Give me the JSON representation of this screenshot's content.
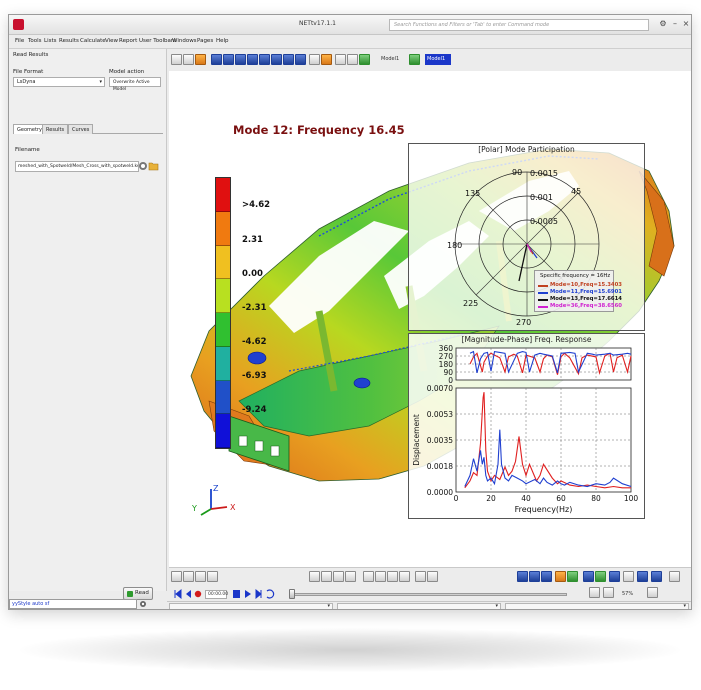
{
  "window": {
    "title": "NETtv17.1.1",
    "command_placeholder": "Search Functions and Filters or 'Tab' to enter Command mode",
    "search_icon_name": "search-icon"
  },
  "menubar": {
    "items": [
      "File",
      "Tools",
      "Lists",
      "Results",
      "Calculate",
      "View",
      "Report",
      "User Toolbars",
      "Windows",
      "Pages",
      "Help"
    ]
  },
  "toolbar_top": {
    "model_label": "Model1",
    "model_chip": "Model1"
  },
  "left_panel": {
    "section_title": "Read Results",
    "file_format_label": "File Format",
    "file_format_value": "LsDyna",
    "model_action_label": "Model action",
    "model_action_value": "Overwrite Active Model",
    "tabs": [
      "Geometry",
      "Results",
      "Curves"
    ],
    "filename_label": "Filename",
    "filename_value": "meshed_with_Spotweld/Mesh_Cross_with_spotweld.key",
    "read_button": "Read"
  },
  "command_input": {
    "value": "yyStyle auto sf"
  },
  "viewport": {
    "title": "Mode 12:  Frequency 16.45",
    "colorbar": {
      "labels": [
        ">4.62",
        "2.31",
        "0.00",
        "-2.31",
        "-4.62",
        "-6.93",
        "-9.24"
      ],
      "colors": [
        "#e01010",
        "#f07a10",
        "#f0c020",
        "#b8e020",
        "#30c030",
        "#20b0a0",
        "#2050c8",
        "#1010d8"
      ]
    },
    "triad": {
      "x": "X",
      "y": "Y",
      "z": "Z"
    }
  },
  "polar_plot": {
    "title": "[Polar] Mode Participation",
    "radial_labels": [
      "0.0015",
      "0.001",
      "0.0005"
    ],
    "angle_labels": [
      "90",
      "45",
      "135",
      "180",
      "225",
      "270"
    ],
    "legend_title": "Specific frequency = 16Hz",
    "legend": [
      {
        "label": "Mode=10,Freq=15.3403",
        "color": "#c04020"
      },
      {
        "label": "Mode=11,Freq=15.6901",
        "color": "#2040d0"
      },
      {
        "label": "Mode=13,Freq=17.6614",
        "color": "#111111"
      },
      {
        "label": "Mode=36,Freq=38.6560",
        "color": "#d020d0"
      }
    ]
  },
  "chart_data": [
    {
      "type": "line",
      "title": "[Magnitude-Phase] Freq. Response",
      "panel": "phase",
      "ytick_labels": [
        "360",
        "270",
        "180",
        "90",
        "0"
      ],
      "ylim": [
        0,
        360
      ],
      "xlim": [
        0,
        100
      ],
      "series": [
        {
          "color": "#e02020",
          "x": [
            8,
            10,
            12,
            15,
            16,
            18,
            20,
            22,
            25,
            28,
            30,
            33,
            35,
            38,
            40,
            45,
            48,
            50,
            52,
            55,
            58,
            60,
            62,
            65,
            70,
            72,
            75,
            80,
            82,
            85,
            88,
            90,
            92,
            95,
            98,
            100
          ],
          "y": [
            180,
            260,
            300,
            90,
            200,
            270,
            300,
            280,
            250,
            90,
            260,
            290,
            270,
            80,
            280,
            250,
            90,
            240,
            280,
            260,
            60,
            260,
            300,
            250,
            70,
            250,
            280,
            260,
            80,
            270,
            300,
            90,
            250,
            280,
            90,
            270
          ]
        },
        {
          "color": "#2040d0",
          "x": [
            8,
            10,
            12,
            14,
            16,
            18,
            20,
            22,
            25,
            28,
            30,
            35,
            38,
            40,
            42,
            45,
            48,
            50,
            55,
            58,
            60,
            65,
            68,
            70,
            75,
            78,
            80,
            85,
            88,
            90,
            95,
            98,
            100
          ],
          "y": [
            300,
            320,
            80,
            240,
            300,
            310,
            100,
            320,
            310,
            300,
            90,
            300,
            320,
            310,
            90,
            280,
            300,
            290,
            270,
            80,
            300,
            310,
            300,
            90,
            300,
            290,
            280,
            290,
            300,
            280,
            290,
            300,
            290
          ]
        }
      ]
    },
    {
      "type": "line",
      "panel": "magnitude",
      "ylabel": "Displacement",
      "xlabel": "Frequency(Hz)",
      "xtick_labels": [
        "0",
        "20",
        "40",
        "60",
        "80",
        "100"
      ],
      "ytick_labels": [
        "0.0070",
        "0.0053",
        "0.0035",
        "0.0018",
        "0.0000"
      ],
      "xlim": [
        0,
        100
      ],
      "ylim": [
        0,
        0.0075
      ],
      "series": [
        {
          "color": "#e02020",
          "x": [
            5,
            8,
            10,
            12,
            14,
            15.5,
            16,
            17,
            18,
            20,
            22,
            25,
            28,
            30,
            32,
            34,
            36,
            38,
            40,
            42,
            44,
            46,
            48,
            50,
            55,
            58,
            60,
            65,
            70,
            75,
            80,
            85,
            90,
            95,
            100
          ],
          "y": [
            0.0003,
            0.0008,
            0.0014,
            0.0012,
            0.0035,
            0.0068,
            0.0072,
            0.003,
            0.0015,
            0.0008,
            0.0012,
            0.0009,
            0.0018,
            0.0012,
            0.0015,
            0.0022,
            0.004,
            0.002,
            0.0012,
            0.002,
            0.0014,
            0.0008,
            0.0012,
            0.002,
            0.001,
            0.0006,
            0.0008,
            0.0005,
            0.0004,
            0.0005,
            0.0004,
            0.0003,
            0.0004,
            0.0003,
            0.0003
          ]
        },
        {
          "color": "#2040d0",
          "x": [
            5,
            8,
            10,
            12,
            14,
            15,
            16,
            17,
            18,
            20,
            22,
            24,
            25,
            26,
            28,
            30,
            32,
            35,
            38,
            40,
            45,
            48,
            50,
            52,
            55,
            58,
            60,
            62,
            65,
            70,
            75,
            80,
            85,
            88,
            90,
            95,
            100
          ],
          "y": [
            0.0004,
            0.0012,
            0.0024,
            0.0015,
            0.003,
            0.002,
            0.0025,
            0.0012,
            0.0008,
            0.001,
            0.0006,
            0.002,
            0.0045,
            0.002,
            0.001,
            0.0008,
            0.0012,
            0.001,
            0.0008,
            0.0006,
            0.0009,
            0.0006,
            0.001,
            0.0007,
            0.0005,
            0.0008,
            0.0006,
            0.0005,
            0.0007,
            0.0005,
            0.0004,
            0.0006,
            0.0005,
            0.0007,
            0.001,
            0.0006,
            0.0004
          ]
        }
      ]
    }
  ],
  "bottom_toolbar": {
    "time_value": "00:00.00",
    "percent_value": "57%"
  }
}
